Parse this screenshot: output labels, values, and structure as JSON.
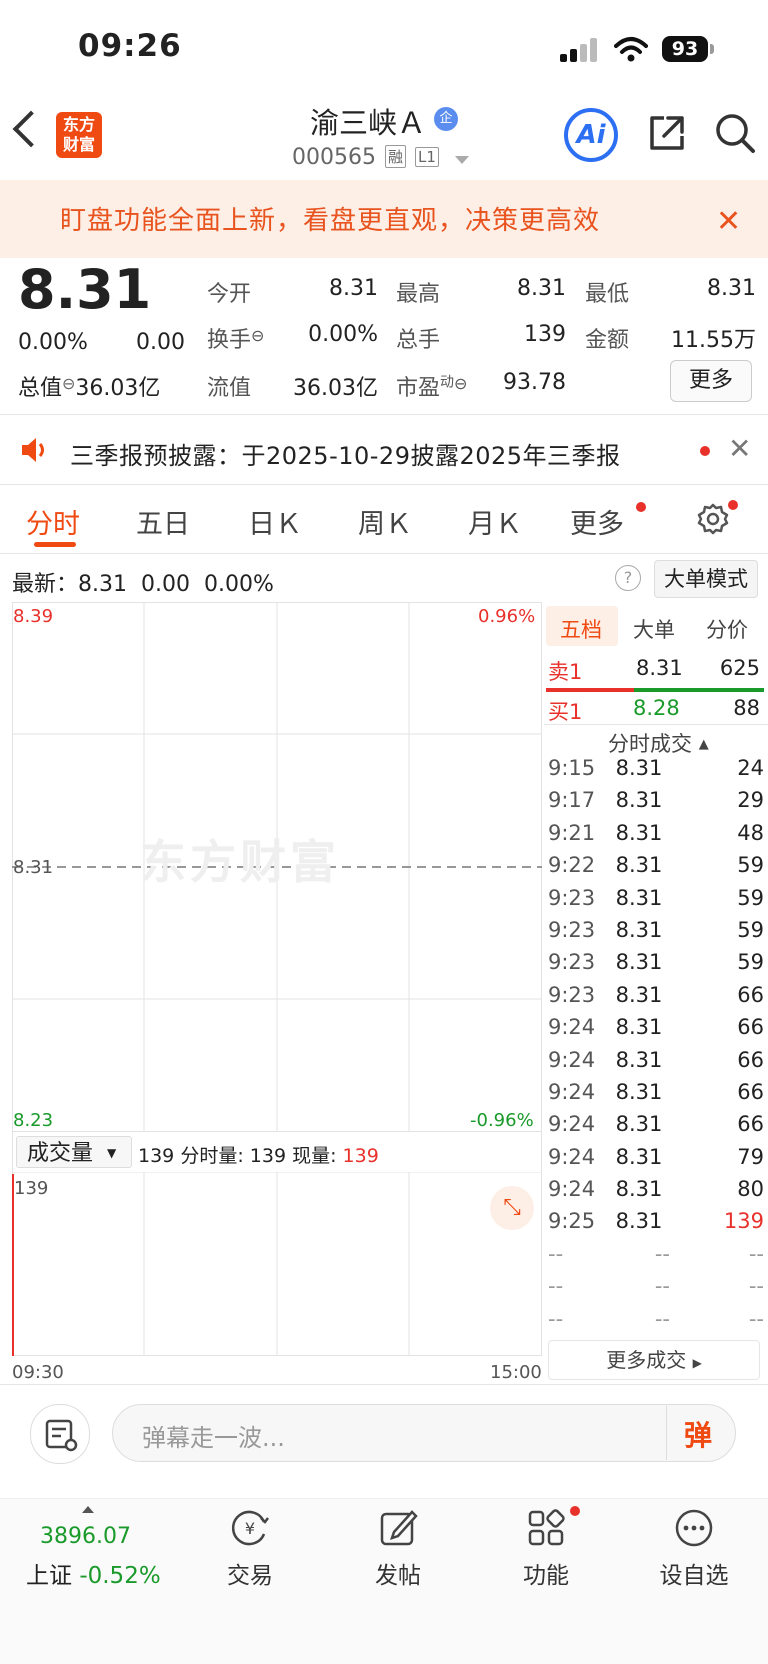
{
  "status_bar": {
    "time": "09:26",
    "battery": "93"
  },
  "header": {
    "stock_name": "渝三峡Ａ",
    "badge": "企",
    "code": "000565",
    "tags": [
      "融",
      "L1"
    ],
    "logo_line1": "东方",
    "logo_line2": "财富",
    "ai_label": "Ai"
  },
  "banner": {
    "text": "盯盘功能全面上新，看盘更直观，决策更高效"
  },
  "quote": {
    "price": "8.31",
    "change_pct": "0.00%",
    "change": "0.00",
    "total_value_label": "总值",
    "total_value": "36.03亿",
    "fields": [
      {
        "label": "今开",
        "value": "8.31"
      },
      {
        "label": "最高",
        "value": "8.31"
      },
      {
        "label": "最低",
        "value": "8.31"
      },
      {
        "label": "换手",
        "value": "0.00%"
      },
      {
        "label": "总手",
        "value": "139"
      },
      {
        "label": "金额",
        "value": "11.55万"
      },
      {
        "label": "流值",
        "value": "36.03亿"
      },
      {
        "label": "市盈",
        "sup": "动",
        "value": "93.78"
      }
    ],
    "more_button": "更多"
  },
  "notice": {
    "text": "三季报预披露：于2025-10-29披露2025年三季报"
  },
  "tabs": [
    "分时",
    "五日",
    "日Ｋ",
    "周Ｋ",
    "月Ｋ",
    "更多"
  ],
  "info_row": {
    "latest_label": "最新：",
    "latest_price": "8.31",
    "latest_change": "0.00",
    "latest_pct": "0.00%",
    "big_order_mode": "大单模式"
  },
  "chart": {
    "y_top": "8.39",
    "y_mid": "8.31",
    "y_bottom": "8.23",
    "pct_top": "0.96%",
    "pct_bottom": "-0.96%",
    "watermark": "东方财富",
    "volume_select": "成交量",
    "vol_total": "139",
    "vol_interval_label": "分时量:",
    "vol_interval": "139",
    "vol_now_label": "现量:",
    "vol_now": "139",
    "vol_axis_max": "139",
    "time_start": "09:30",
    "time_end": "15:00"
  },
  "right_panel": {
    "tabs": [
      "五档",
      "大单",
      "分价"
    ],
    "sell1": {
      "label": "卖1",
      "price": "8.31",
      "vol": "625"
    },
    "buy1": {
      "label": "买1",
      "price": "8.28",
      "vol": "88"
    },
    "trades_header": "分时成交",
    "trades": [
      {
        "time": "9:15",
        "price": "8.31",
        "vol": "24"
      },
      {
        "time": "9:17",
        "price": "8.31",
        "vol": "29"
      },
      {
        "time": "9:21",
        "price": "8.31",
        "vol": "48"
      },
      {
        "time": "9:22",
        "price": "8.31",
        "vol": "59"
      },
      {
        "time": "9:23",
        "price": "8.31",
        "vol": "59"
      },
      {
        "time": "9:23",
        "price": "8.31",
        "vol": "59"
      },
      {
        "time": "9:23",
        "price": "8.31",
        "vol": "59"
      },
      {
        "time": "9:23",
        "price": "8.31",
        "vol": "66"
      },
      {
        "time": "9:24",
        "price": "8.31",
        "vol": "66"
      },
      {
        "time": "9:24",
        "price": "8.31",
        "vol": "66"
      },
      {
        "time": "9:24",
        "price": "8.31",
        "vol": "66"
      },
      {
        "time": "9:24",
        "price": "8.31",
        "vol": "66"
      },
      {
        "time": "9:24",
        "price": "8.31",
        "vol": "79"
      },
      {
        "time": "9:24",
        "price": "8.31",
        "vol": "80"
      },
      {
        "time": "9:25",
        "price": "8.31",
        "vol": "139"
      },
      {
        "time": "--",
        "price": "--",
        "vol": "--"
      },
      {
        "time": "--",
        "price": "--",
        "vol": "--"
      },
      {
        "time": "--",
        "price": "--",
        "vol": "--"
      }
    ],
    "more_trades": "更多成交"
  },
  "comment_bar": {
    "placeholder": "弹幕走一波...",
    "dan": "弹"
  },
  "bottom_nav": {
    "index_value": "3896.07",
    "index_name": "上证",
    "index_pct": "-0.52%",
    "items": [
      "交易",
      "发帖",
      "功能",
      "设自选"
    ]
  }
}
